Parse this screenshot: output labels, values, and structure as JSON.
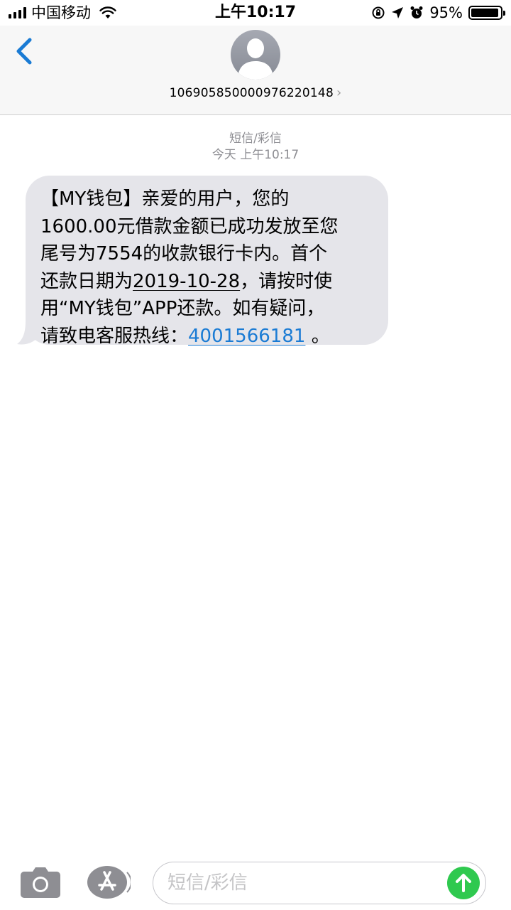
{
  "status_bar": {
    "carrier": "中国移动",
    "time": "上午10:17",
    "battery_percent_label": "95%",
    "battery_level": 0.95
  },
  "header": {
    "back_icon": "chevron-left-icon",
    "avatar_icon": "person-silhouette-icon",
    "contact_number": "106905850000976220148",
    "contact_chevron": "›"
  },
  "thread": {
    "type_label": "短信/彩信",
    "timestamp": "今天 上午10:17",
    "message": {
      "lines": [
        "【MY钱包】亲爱的用户，您的",
        "1600.00元借款金额已成功发放至您",
        "尾号为7554的收款银行卡内。首个"
      ],
      "line4_prefix": "还款日期为",
      "date_link": "2019-10-28",
      "line4_suffix": "，请按时使",
      "line5": "用“MY钱包”APP还款。如有疑问，",
      "line6_prefix": "请致电客服热线：",
      "phone_link": "4001566181",
      "line6_suffix": " 。"
    }
  },
  "input_bar": {
    "placeholder": "短信/彩信",
    "camera_icon": "camera-icon",
    "appstore_icon": "app-store-icon",
    "send_icon": "arrow-up-icon"
  },
  "colors": {
    "accent": "#1a7bd4",
    "bubble": "#e5e5ea",
    "send": "#2fc94f"
  }
}
